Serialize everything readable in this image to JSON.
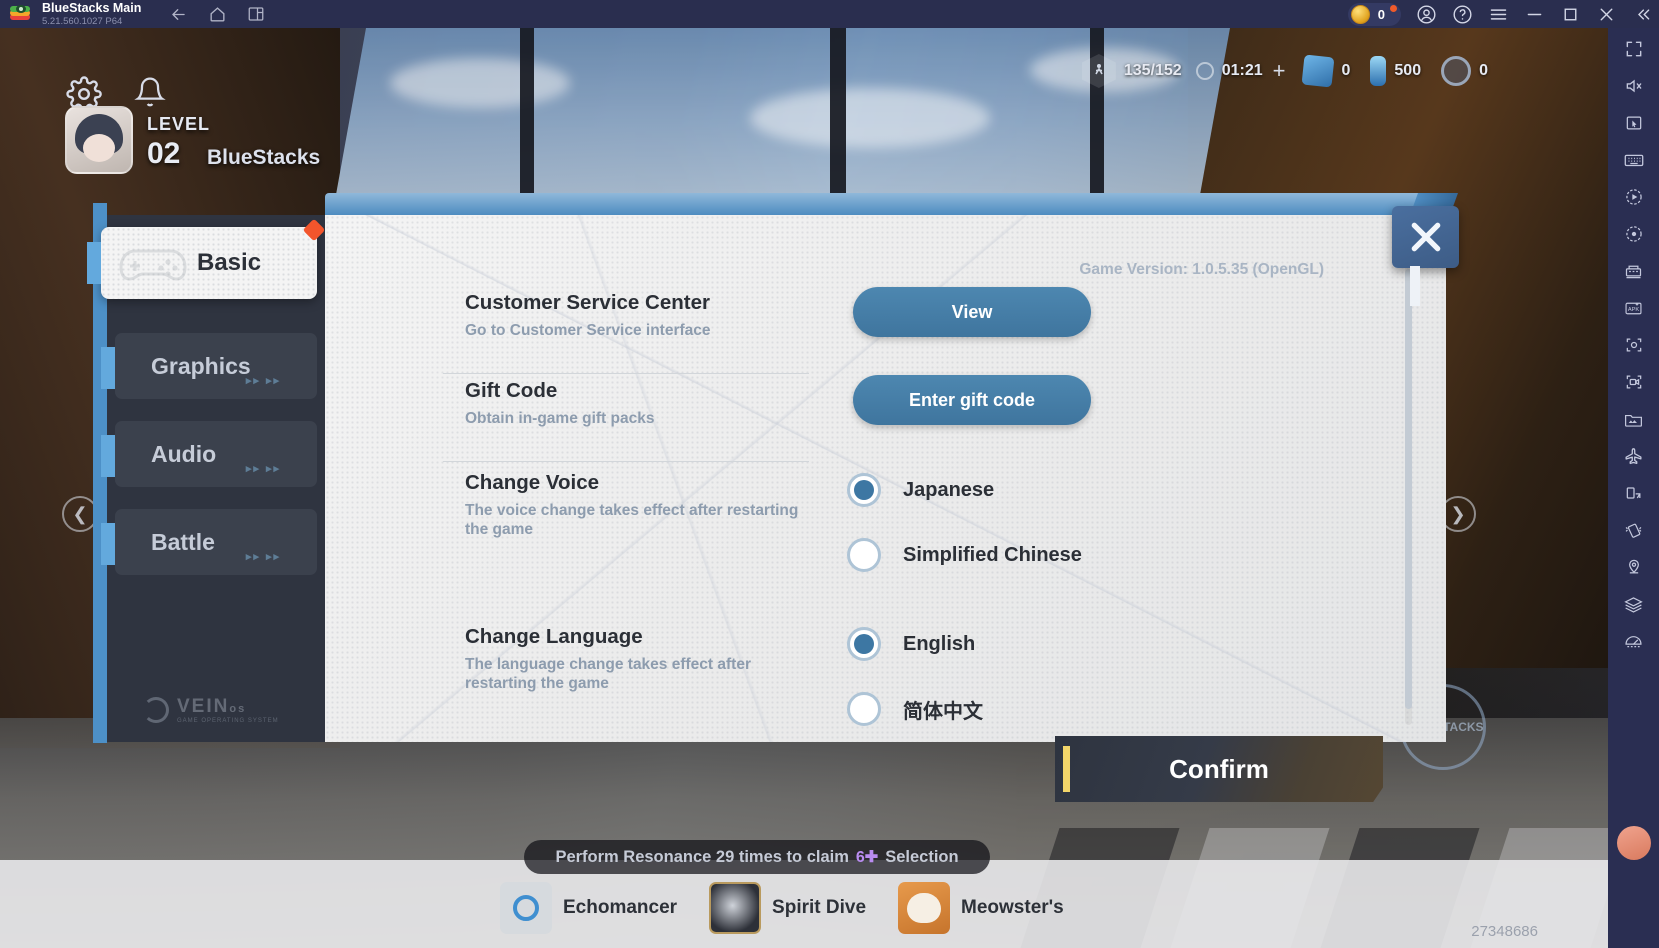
{
  "titlebar": {
    "app_name": "BlueStacks Main",
    "version": "5.21.560.1027  P64",
    "icons": [
      "back-arrow-icon",
      "home-icon",
      "multi-instance-icon"
    ],
    "coin_count": "0",
    "right_icons": [
      "account-icon",
      "help-icon",
      "menu-icon",
      "minimize-icon",
      "maximize-icon",
      "close-icon",
      "collapse-icon"
    ]
  },
  "sidebar": {
    "icons": [
      "fullscreen-icon",
      "mute-icon",
      "cursor-icon",
      "keyboard-icon",
      "macro-play-icon",
      "record-macro-icon",
      "multi-instance-manager-icon",
      "install-apk-icon",
      "screenshot-icon",
      "screen-record-icon",
      "media-manager-icon",
      "airplane-mode-icon",
      "rotate-screen-icon",
      "shake-icon",
      "location-icon",
      "layers-icon",
      "eco-mode-icon"
    ]
  },
  "game_hud": {
    "stamina": "135/152",
    "timer": "01:21",
    "currency_1": "0",
    "currency_2": "500",
    "currency_3": "0",
    "level_label": "LEVEL",
    "level_value": "02",
    "nickname": "BlueStacks",
    "gear_icon": "settings-gear-icon",
    "bell_icon": "notification-bell-icon",
    "prev_arrow": "prev-arrow-icon",
    "next_arrow": "next-arrow-icon"
  },
  "dialog": {
    "version_text": "Game Version: 1.0.5.35 (OpenGL)",
    "close_label": "close-dialog",
    "tabs": [
      {
        "label": "Basic",
        "active": true,
        "badge": true,
        "arrows": ""
      },
      {
        "label": "Graphics",
        "active": false,
        "badge": false,
        "arrows": "▸▸ ▸▸"
      },
      {
        "label": "Audio",
        "active": false,
        "badge": false,
        "arrows": "▸▸ ▸▸"
      },
      {
        "label": "Battle",
        "active": false,
        "badge": false,
        "arrows": "▸▸ ▸▸"
      }
    ],
    "os_logo": {
      "name": "VEIN",
      "suffix": "os",
      "sub": "GAME OPERATING SYSTEM"
    },
    "rows": [
      {
        "title": "Customer Service Center",
        "desc": "Go to Customer Service interface",
        "control": "button",
        "button_label": "View"
      },
      {
        "title": "Gift Code",
        "desc": "Obtain in-game gift packs",
        "control": "button",
        "button_label": "Enter gift code"
      },
      {
        "title": "Change Voice",
        "desc": "The voice change takes effect after restarting the game",
        "control": "radio",
        "options": [
          {
            "label": "Japanese",
            "selected": true
          },
          {
            "label": "Simplified Chinese",
            "selected": false
          }
        ]
      },
      {
        "title": "Change Language",
        "desc": "The language change takes effect after restarting the game",
        "control": "radio",
        "options": [
          {
            "label": "English",
            "selected": true
          },
          {
            "label": "简体中文",
            "selected": false
          }
        ]
      }
    ]
  },
  "confirm_button": {
    "label": "Confirm"
  },
  "bottom": {
    "resonance_prefix": "Perform Resonance 29 times to claim",
    "resonance_icon": "6-star-selector-icon",
    "resonance_suffix": "Selection",
    "nav_items": [
      {
        "label": "Echomancer",
        "icon": "echomancer-icon"
      },
      {
        "label": "Spirit Dive",
        "icon": "spirit-dive-icon"
      },
      {
        "label": "Meowster's",
        "icon": "meowster-icon"
      }
    ],
    "watermark": "27348686",
    "badge_text": "BLUESTACKS"
  },
  "colors": {
    "accent_blue": "#4d87b0",
    "titlebar": "#2a2e4f",
    "sidebar": "#2a2e52",
    "dialog_bg": "#f1f1f1",
    "badge_red": "#f2552c"
  }
}
